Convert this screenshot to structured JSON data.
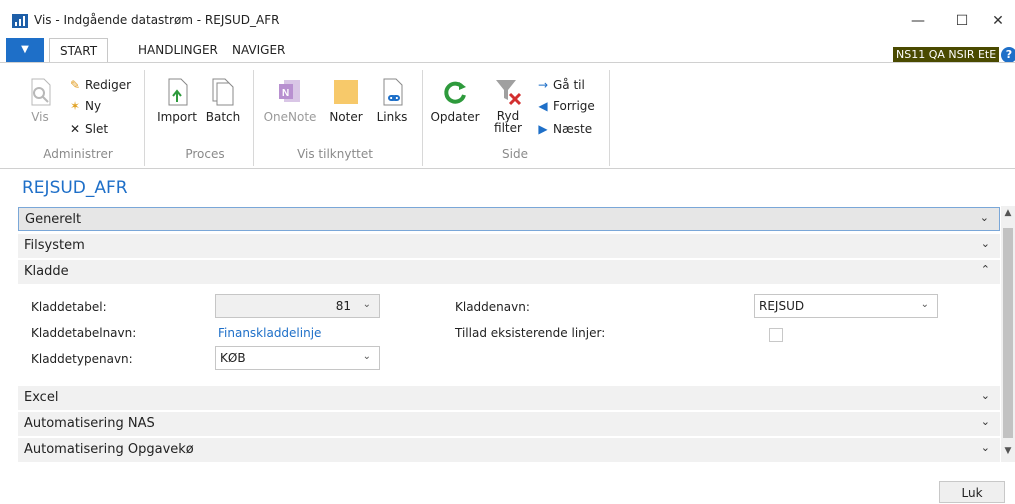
{
  "window": {
    "title": "Vis - Indgående datastrøm - REJSUD_AFR",
    "minimize": "—",
    "maximize": "☐",
    "close": "✕"
  },
  "ribbon_tabs": {
    "file_glyph": "▼",
    "tabs": [
      "START",
      "HANDLINGER",
      "NAVIGER"
    ],
    "badge": "NS11 QA NSIR EtE",
    "help": "?"
  },
  "ribbon": {
    "groups": {
      "administrer": "Administrer",
      "proces": "Proces",
      "vis_tilknyttet": "Vis tilknyttet",
      "side": "Side"
    },
    "buttons": {
      "vis": "Vis",
      "rediger": "Rediger",
      "ny": "Ny",
      "slet": "Slet",
      "import": "Import",
      "batch": "Batch",
      "onenote": "OneNote",
      "noter": "Noter",
      "links": "Links",
      "opdater": "Opdater",
      "ryd_filter_1": "Ryd",
      "ryd_filter_2": "filter",
      "gaa_til": "Gå til",
      "forrige": "Forrige",
      "naeste": "Næste"
    }
  },
  "page": {
    "title": "REJSUD_AFR"
  },
  "fasttabs": {
    "generelt": "Generelt",
    "filsystem": "Filsystem",
    "kladde": "Kladde",
    "excel": "Excel",
    "automatisering_nas": "Automatisering NAS",
    "automatisering_opgavekoe": "Automatisering Opgavekø"
  },
  "kladde": {
    "kladdetabel_label": "Kladdetabel:",
    "kladdetabel_value": "81",
    "kladdetabelnavn_label": "Kladdetabelnavn:",
    "kladdetabelnavn_value": "Finanskladdelinje",
    "kladdetypenavn_label": "Kladdetypenavn:",
    "kladdetypenavn_value": "KØB",
    "kladdenavn_label": "Kladdenavn:",
    "kladdenavn_value": "REJSUD",
    "tillad_label": "Tillad eksisterende linjer:",
    "tillad_checked": false
  },
  "footer": {
    "close_button": "Luk"
  },
  "colors": {
    "accent": "#1e6fc8",
    "badge_bg": "#4a4a00",
    "fasttab_bg": "#f1f1f1"
  }
}
